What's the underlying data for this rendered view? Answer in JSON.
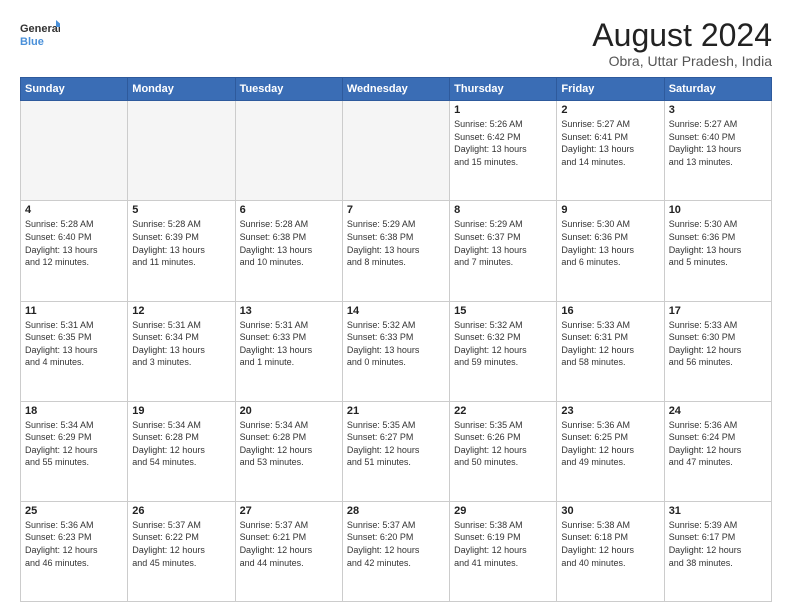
{
  "header": {
    "logo_line1": "General",
    "logo_line2": "Blue",
    "title": "August 2024",
    "subtitle": "Obra, Uttar Pradesh, India"
  },
  "weekdays": [
    "Sunday",
    "Monday",
    "Tuesday",
    "Wednesday",
    "Thursday",
    "Friday",
    "Saturday"
  ],
  "weeks": [
    [
      {
        "day": "",
        "info": ""
      },
      {
        "day": "",
        "info": ""
      },
      {
        "day": "",
        "info": ""
      },
      {
        "day": "",
        "info": ""
      },
      {
        "day": "1",
        "info": "Sunrise: 5:26 AM\nSunset: 6:42 PM\nDaylight: 13 hours\nand 15 minutes."
      },
      {
        "day": "2",
        "info": "Sunrise: 5:27 AM\nSunset: 6:41 PM\nDaylight: 13 hours\nand 14 minutes."
      },
      {
        "day": "3",
        "info": "Sunrise: 5:27 AM\nSunset: 6:40 PM\nDaylight: 13 hours\nand 13 minutes."
      }
    ],
    [
      {
        "day": "4",
        "info": "Sunrise: 5:28 AM\nSunset: 6:40 PM\nDaylight: 13 hours\nand 12 minutes."
      },
      {
        "day": "5",
        "info": "Sunrise: 5:28 AM\nSunset: 6:39 PM\nDaylight: 13 hours\nand 11 minutes."
      },
      {
        "day": "6",
        "info": "Sunrise: 5:28 AM\nSunset: 6:38 PM\nDaylight: 13 hours\nand 10 minutes."
      },
      {
        "day": "7",
        "info": "Sunrise: 5:29 AM\nSunset: 6:38 PM\nDaylight: 13 hours\nand 8 minutes."
      },
      {
        "day": "8",
        "info": "Sunrise: 5:29 AM\nSunset: 6:37 PM\nDaylight: 13 hours\nand 7 minutes."
      },
      {
        "day": "9",
        "info": "Sunrise: 5:30 AM\nSunset: 6:36 PM\nDaylight: 13 hours\nand 6 minutes."
      },
      {
        "day": "10",
        "info": "Sunrise: 5:30 AM\nSunset: 6:36 PM\nDaylight: 13 hours\nand 5 minutes."
      }
    ],
    [
      {
        "day": "11",
        "info": "Sunrise: 5:31 AM\nSunset: 6:35 PM\nDaylight: 13 hours\nand 4 minutes."
      },
      {
        "day": "12",
        "info": "Sunrise: 5:31 AM\nSunset: 6:34 PM\nDaylight: 13 hours\nand 3 minutes."
      },
      {
        "day": "13",
        "info": "Sunrise: 5:31 AM\nSunset: 6:33 PM\nDaylight: 13 hours\nand 1 minute."
      },
      {
        "day": "14",
        "info": "Sunrise: 5:32 AM\nSunset: 6:33 PM\nDaylight: 13 hours\nand 0 minutes."
      },
      {
        "day": "15",
        "info": "Sunrise: 5:32 AM\nSunset: 6:32 PM\nDaylight: 12 hours\nand 59 minutes."
      },
      {
        "day": "16",
        "info": "Sunrise: 5:33 AM\nSunset: 6:31 PM\nDaylight: 12 hours\nand 58 minutes."
      },
      {
        "day": "17",
        "info": "Sunrise: 5:33 AM\nSunset: 6:30 PM\nDaylight: 12 hours\nand 56 minutes."
      }
    ],
    [
      {
        "day": "18",
        "info": "Sunrise: 5:34 AM\nSunset: 6:29 PM\nDaylight: 12 hours\nand 55 minutes."
      },
      {
        "day": "19",
        "info": "Sunrise: 5:34 AM\nSunset: 6:28 PM\nDaylight: 12 hours\nand 54 minutes."
      },
      {
        "day": "20",
        "info": "Sunrise: 5:34 AM\nSunset: 6:28 PM\nDaylight: 12 hours\nand 53 minutes."
      },
      {
        "day": "21",
        "info": "Sunrise: 5:35 AM\nSunset: 6:27 PM\nDaylight: 12 hours\nand 51 minutes."
      },
      {
        "day": "22",
        "info": "Sunrise: 5:35 AM\nSunset: 6:26 PM\nDaylight: 12 hours\nand 50 minutes."
      },
      {
        "day": "23",
        "info": "Sunrise: 5:36 AM\nSunset: 6:25 PM\nDaylight: 12 hours\nand 49 minutes."
      },
      {
        "day": "24",
        "info": "Sunrise: 5:36 AM\nSunset: 6:24 PM\nDaylight: 12 hours\nand 47 minutes."
      }
    ],
    [
      {
        "day": "25",
        "info": "Sunrise: 5:36 AM\nSunset: 6:23 PM\nDaylight: 12 hours\nand 46 minutes."
      },
      {
        "day": "26",
        "info": "Sunrise: 5:37 AM\nSunset: 6:22 PM\nDaylight: 12 hours\nand 45 minutes."
      },
      {
        "day": "27",
        "info": "Sunrise: 5:37 AM\nSunset: 6:21 PM\nDaylight: 12 hours\nand 44 minutes."
      },
      {
        "day": "28",
        "info": "Sunrise: 5:37 AM\nSunset: 6:20 PM\nDaylight: 12 hours\nand 42 minutes."
      },
      {
        "day": "29",
        "info": "Sunrise: 5:38 AM\nSunset: 6:19 PM\nDaylight: 12 hours\nand 41 minutes."
      },
      {
        "day": "30",
        "info": "Sunrise: 5:38 AM\nSunset: 6:18 PM\nDaylight: 12 hours\nand 40 minutes."
      },
      {
        "day": "31",
        "info": "Sunrise: 5:39 AM\nSunset: 6:17 PM\nDaylight: 12 hours\nand 38 minutes."
      }
    ]
  ]
}
